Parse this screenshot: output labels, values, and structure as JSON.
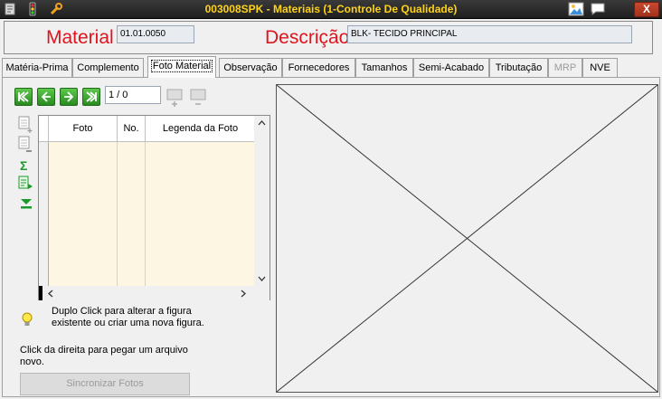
{
  "window": {
    "title": "003008SPK - Materiais (1-Controle De Qualidade)",
    "close_label": "X"
  },
  "header": {
    "material_label": "Material",
    "material_value": "01.01.0050",
    "descricao_label": "Descrição",
    "descricao_value": "BLK- TECIDO PRINCIPAL"
  },
  "tabs": [
    {
      "label": "Matéria-Prima"
    },
    {
      "label": "Complemento"
    },
    {
      "label": "Foto Material"
    },
    {
      "label": "Observação"
    },
    {
      "label": "Fornecedores"
    },
    {
      "label": "Tamanhos"
    },
    {
      "label": "Semi-Acabado"
    },
    {
      "label": "Tributação"
    },
    {
      "label": "MRP"
    },
    {
      "label": "NVE"
    }
  ],
  "active_tab": "Foto Material",
  "navigator": {
    "counter": "1 / 0",
    "buttons": [
      "first-icon",
      "prev-icon",
      "next-icon",
      "last-icon"
    ]
  },
  "grid": {
    "columns": [
      "Foto",
      "No.",
      "Legenda da Foto"
    ],
    "rows": []
  },
  "hints": {
    "double_click": "Duplo Click para alterar a figura existente ou criar uma nova figura.",
    "right_click": "Click da direita para pegar um arquivo novo."
  },
  "sync_button": "Sincronizar Fotos",
  "colors": {
    "title_text": "#ffd21a",
    "header_label": "#e0141e",
    "grid_body": "#fdf6e3"
  }
}
